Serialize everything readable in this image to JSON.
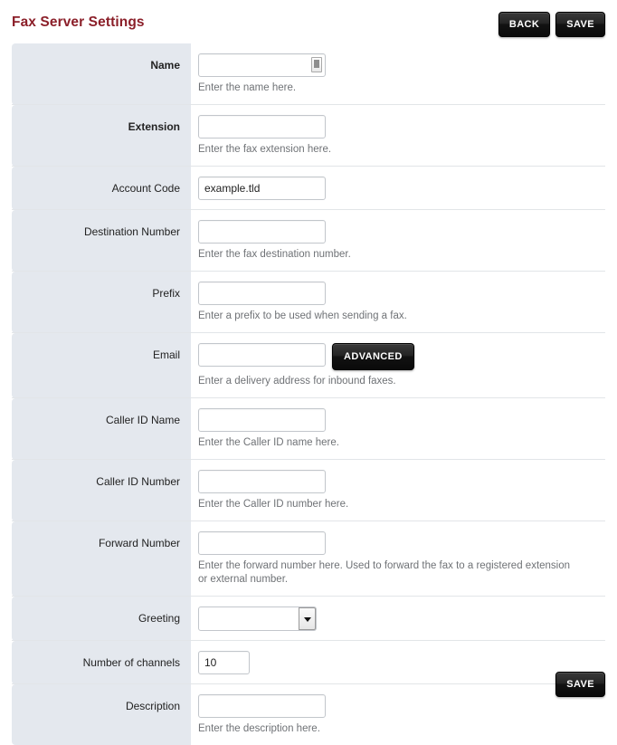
{
  "header": {
    "title": "Fax Server Settings",
    "back_label": "BACK",
    "save_label": "SAVE"
  },
  "footer": {
    "save_label": "SAVE"
  },
  "form": {
    "rows": [
      {
        "label": "Name",
        "required": true,
        "control": "text-with-picker",
        "value": "",
        "icon": "contact-picker-icon",
        "hint": "Enter the name here."
      },
      {
        "label": "Extension",
        "required": true,
        "control": "text",
        "value": "",
        "hint": "Enter the fax extension here."
      },
      {
        "label": "Account Code",
        "required": false,
        "control": "text",
        "value": "example.tld",
        "hint": ""
      },
      {
        "label": "Destination Number",
        "required": false,
        "control": "text",
        "value": "",
        "hint": "Enter the fax destination number."
      },
      {
        "label": "Prefix",
        "required": false,
        "control": "text",
        "value": "",
        "hint": "Enter a prefix to be used when sending a fax."
      },
      {
        "label": "Email",
        "required": false,
        "control": "text-with-button",
        "value": "",
        "button_label": "ADVANCED",
        "hint": "Enter a delivery address for inbound faxes."
      },
      {
        "label": "Caller ID Name",
        "required": false,
        "control": "text",
        "value": "",
        "hint": "Enter the Caller ID name here."
      },
      {
        "label": "Caller ID Number",
        "required": false,
        "control": "text",
        "value": "",
        "hint": "Enter the Caller ID number here."
      },
      {
        "label": "Forward Number",
        "required": false,
        "control": "text",
        "value": "",
        "hint": "Enter the forward number here. Used to forward the fax to a registered extension or external number."
      },
      {
        "label": "Greeting",
        "required": false,
        "control": "select",
        "value": "",
        "hint": ""
      },
      {
        "label": "Number of channels",
        "required": false,
        "control": "text-narrow",
        "value": "10",
        "hint": ""
      },
      {
        "label": "Description",
        "required": false,
        "control": "text",
        "value": "",
        "hint": "Enter the description here."
      }
    ]
  }
}
